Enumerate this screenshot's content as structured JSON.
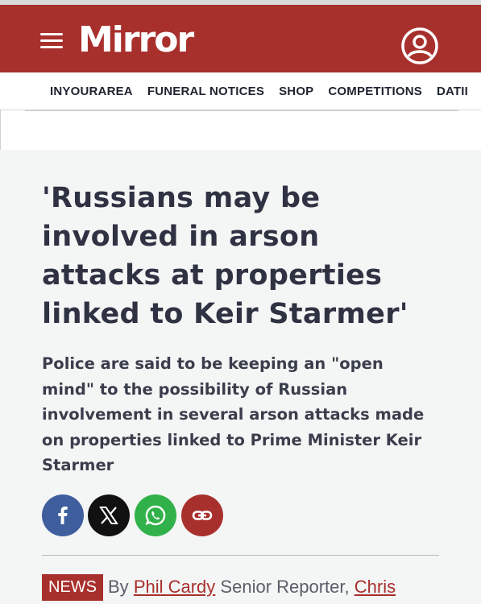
{
  "header": {
    "logo": "Mirror",
    "menu_icon": "hamburger-menu-icon",
    "account_icon": "user-account-icon",
    "brand_color": "#a8302c"
  },
  "nav": {
    "items": [
      "INYOURAREA",
      "FUNERAL NOTICES",
      "SHOP",
      "COMPETITIONS",
      "DATII"
    ]
  },
  "article": {
    "headline": "'Russians may be involved in arson attacks at properties linked to Keir Starmer'",
    "standfirst": "Police are said to be keeping an \"open mind\" to the possibility of Russian involvement in several arson attacks made on properties linked to Prime Minister Keir Starmer",
    "share": {
      "facebook_icon": "facebook-icon",
      "x_icon": "x-twitter-icon",
      "whatsapp_icon": "whatsapp-icon",
      "link_icon": "copy-link-icon"
    },
    "section_badge": "NEWS",
    "byline": {
      "prefix": "By",
      "author1": "Phil Cardy",
      "role1": "Senior Reporter,",
      "author2": "Chris"
    }
  }
}
